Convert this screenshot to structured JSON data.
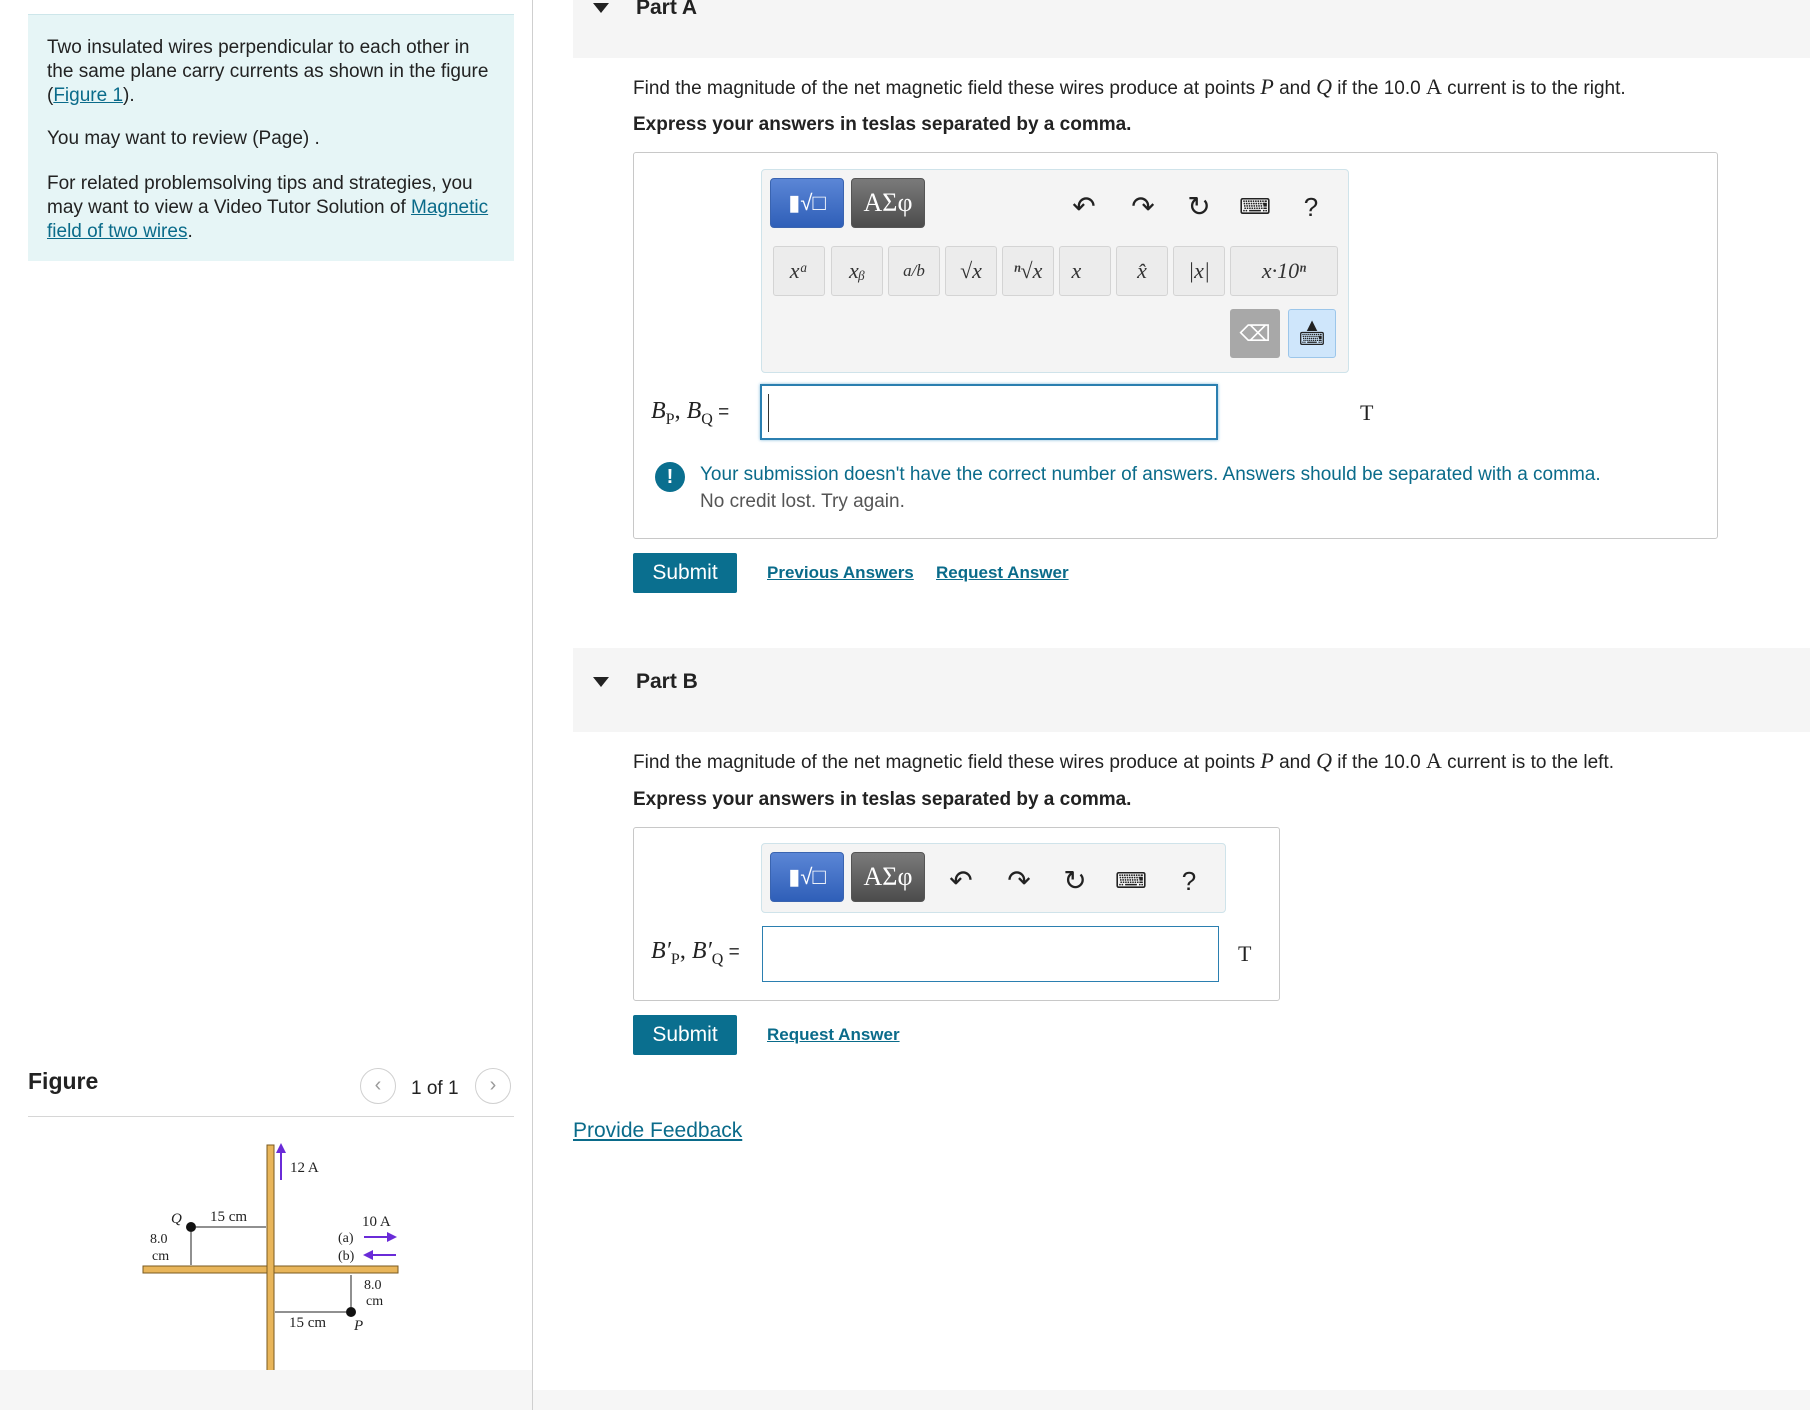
{
  "intro": {
    "p1_before": "Two insulated wires perpendicular to each other in the same plane carry currents as shown in the figure (",
    "p1_link": "Figure 1",
    "p1_after": ").",
    "p2": "You may want to review (Page) .",
    "p3_before": "For related problemsolving tips and strategies, you may want to view a Video Tutor Solution of ",
    "p3_link": "Magnetic field of two wires",
    "p3_after": "."
  },
  "figure": {
    "title": "Figure",
    "prev_icon": "‹",
    "next_icon": "›",
    "pager": "1 of 1",
    "labels": {
      "current_vertical": "12 A",
      "current_horizontal": "10 A",
      "dist_q_horizontal": "15 cm",
      "dist_q_vertical_num": "8.0",
      "dist_q_vertical_unit": "cm",
      "point_q": "Q",
      "point_p": "P",
      "dir_a": "(a)",
      "dir_b": "(b)",
      "dist_p_vertical_num": "8.0",
      "dist_p_vertical_unit": "cm",
      "dist_p_horizontal": "15 cm"
    }
  },
  "partA": {
    "title": "Part A",
    "question_pre": "Find the magnitude of the net magnetic field these wires produce at points ",
    "var_p": "P",
    "and": " and ",
    "var_q": "Q",
    "question_mid": " if the 10.0 ",
    "unit_a": "A",
    "question_end": " current is to the right.",
    "instruction": "Express your answers in teslas separated by a comma.",
    "template_icon": "▮√□",
    "greek_label": "ΑΣφ",
    "keys": [
      "xᵃ",
      "xᵦ",
      "a/b",
      "√x",
      "ⁿ√x",
      "x⃗",
      "x̂",
      "|x|",
      "x·10ⁿ"
    ],
    "label_b": "B",
    "sub_p": "P",
    "comma": ", ",
    "sub_q": "Q",
    "equals": " =",
    "input_value": "",
    "unit": "T",
    "feedback_line1": "Your submission doesn't have the correct number of answers. Answers should be separated with a comma.",
    "feedback_line2": "No credit lost. Try again.",
    "submit": "Submit",
    "previous_answers": "Previous Answers",
    "request_answer": "Request Answer"
  },
  "partB": {
    "title": "Part B",
    "question_pre": "Find the magnitude of the net magnetic field these wires produce at points ",
    "var_p": "P",
    "and": " and ",
    "var_q": "Q",
    "question_mid": " if the 10.0 ",
    "unit_a": "A",
    "question_end": " current is to the left.",
    "instruction": "Express your answers in teslas separated by a comma.",
    "template_icon": "▮√□",
    "greek_label": "ΑΣφ",
    "label_b": "B′",
    "sub_p": "P",
    "comma": ", ",
    "sub_q": "Q",
    "equals": " =",
    "input_value": "",
    "unit": "T",
    "submit": "Submit",
    "request_answer": "Request Answer"
  },
  "feedback_link": "Provide Feedback",
  "icons": {
    "undo": "undo-icon",
    "redo": "redo-icon",
    "reset": "reset-icon",
    "keyboard": "keyboard-icon",
    "help": "?",
    "backspace": "backspace-icon",
    "keyboard_toggle": "keyboard-toggle-icon",
    "warning": "!"
  },
  "colors": {
    "accent": "#0a6f8f",
    "link": "#0a6b8a",
    "intro_bg": "#e6f5f6",
    "input_border": "#2b7fb0",
    "current_arrow": "#6a2bd8",
    "wire": "#e8b55a"
  }
}
